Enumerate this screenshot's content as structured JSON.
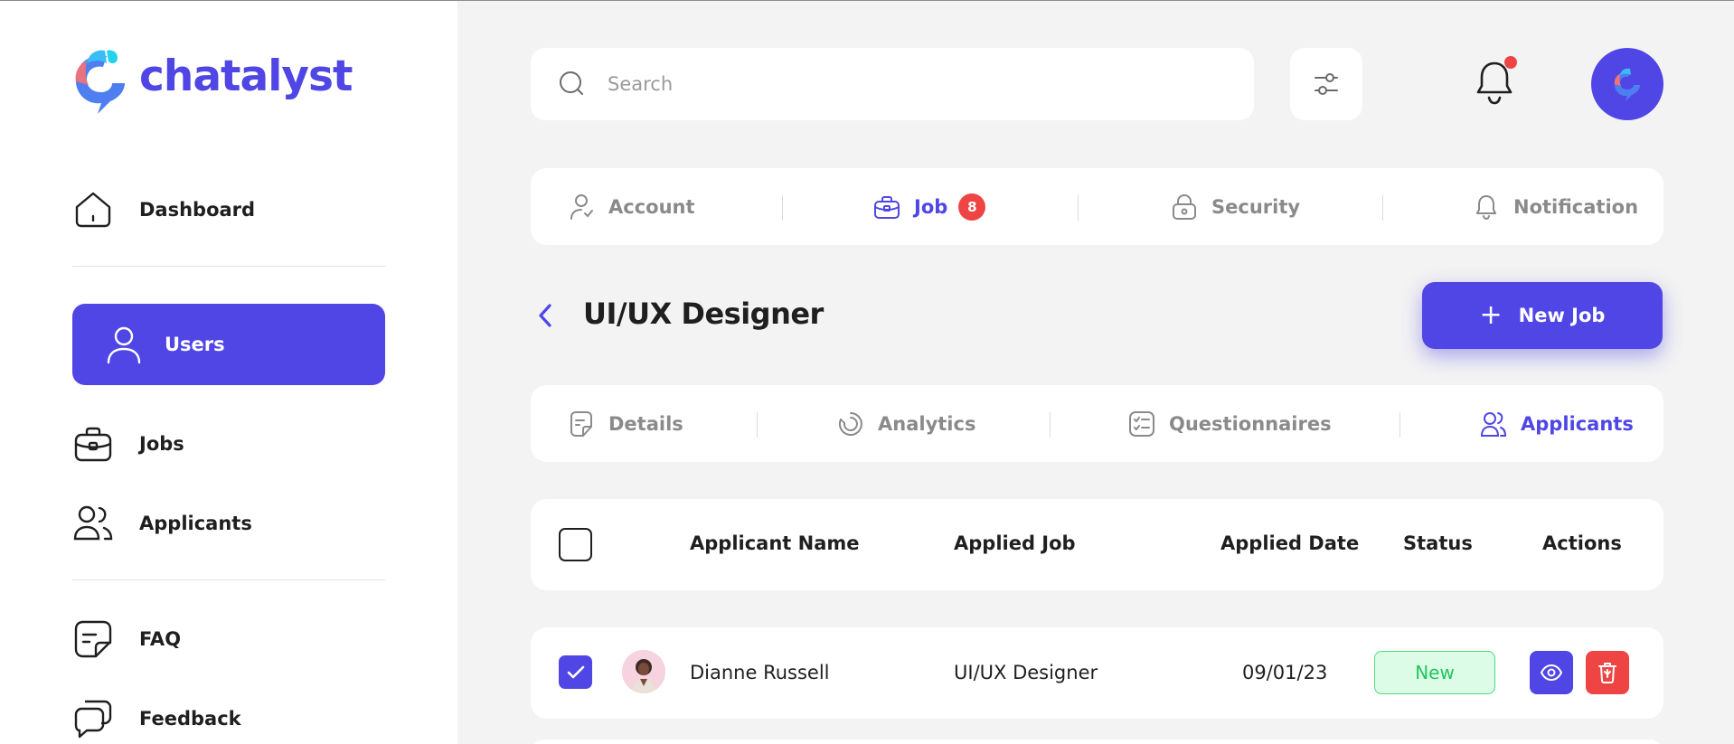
{
  "app": {
    "brand": "chatalyst",
    "accent": "#4f46e5",
    "danger": "#ef4444",
    "success": "#22c55e"
  },
  "sidebar": {
    "items": [
      {
        "label": "Dashboard",
        "icon": "home-icon"
      },
      {
        "label": "Users",
        "icon": "user-icon",
        "active": true
      },
      {
        "label": "Jobs",
        "icon": "briefcase-icon"
      },
      {
        "label": "Applicants",
        "icon": "users-icon"
      },
      {
        "label": "FAQ",
        "icon": "note-icon"
      },
      {
        "label": "Feedback",
        "icon": "chat-icon"
      }
    ]
  },
  "header": {
    "search_placeholder": "Search",
    "notification_dot": true
  },
  "settings_tabs": {
    "items": [
      {
        "label": "Account",
        "icon": "user-icon"
      },
      {
        "label": "Job",
        "icon": "briefcase-icon",
        "badge": "8",
        "active": true
      },
      {
        "label": "Security",
        "icon": "lock-icon"
      },
      {
        "label": "Notification",
        "icon": "bell-icon"
      }
    ]
  },
  "page": {
    "title": "UI/UX Designer",
    "new_job_label": "New Job"
  },
  "job_tabs": {
    "items": [
      {
        "label": "Details",
        "icon": "document-icon"
      },
      {
        "label": "Analytics",
        "icon": "analytics-icon"
      },
      {
        "label": "Questionnaires",
        "icon": "checklist-icon"
      },
      {
        "label": "Applicants",
        "icon": "users-icon",
        "active": true
      }
    ]
  },
  "table": {
    "columns": [
      "Applicant Name",
      "Applied Job",
      "Applied Date",
      "Status",
      "Actions"
    ],
    "rows": [
      {
        "checked": true,
        "name": "Dianne Russell",
        "job": "UI/UX Designer",
        "date": "09/01/23",
        "status": "New"
      }
    ]
  }
}
